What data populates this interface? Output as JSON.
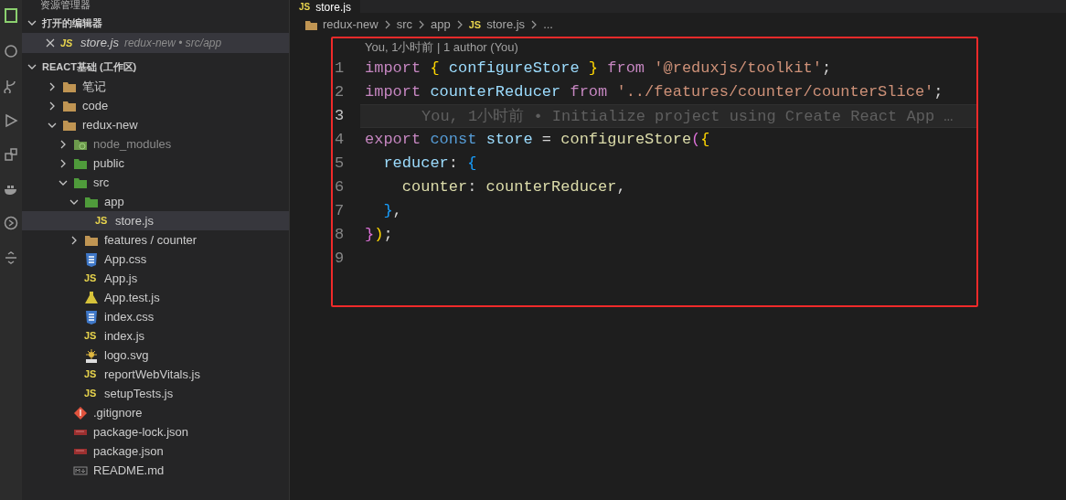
{
  "sidebar": {
    "title": "资源管理器",
    "open_editors": {
      "label": "打开的编辑器",
      "expanded": true,
      "items": [
        {
          "kind": "js",
          "badge": "JS",
          "label": "store.js",
          "description": "redux-new • src/app",
          "selected": true
        }
      ]
    },
    "workspace": {
      "label": "REACT基础 (工作区)",
      "expanded": true,
      "items": [
        {
          "kind": "folder",
          "label": "笔记",
          "expanded": false,
          "selected": false
        },
        {
          "kind": "folder",
          "label": "code",
          "expanded": false,
          "selected": false
        },
        {
          "kind": "folder",
          "label": "redux-new",
          "expanded": true,
          "selected": false,
          "children": [
            {
              "kind": "folder-node",
              "label": "node_modules",
              "expanded": false,
              "selected": false,
              "dimmed": true
            },
            {
              "kind": "folder-green",
              "label": "public",
              "expanded": false,
              "selected": false
            },
            {
              "kind": "folder-green",
              "label": "src",
              "expanded": true,
              "selected": false,
              "children": [
                {
                  "kind": "folder-green",
                  "label": "app",
                  "expanded": true,
                  "selected": false,
                  "children": [
                    {
                      "kind": "js",
                      "badge": "JS",
                      "label": "store.js",
                      "selected": true
                    }
                  ]
                },
                {
                  "kind": "folder",
                  "label": "features / counter",
                  "expanded": false,
                  "selected": false
                },
                {
                  "kind": "css",
                  "label": "App.css",
                  "selected": false
                },
                {
                  "kind": "js",
                  "badge": "JS",
                  "label": "App.js",
                  "selected": false
                },
                {
                  "kind": "test",
                  "label": "App.test.js",
                  "selected": false
                },
                {
                  "kind": "css",
                  "label": "index.css",
                  "selected": false
                },
                {
                  "kind": "js",
                  "badge": "JS",
                  "label": "index.js",
                  "selected": false
                },
                {
                  "kind": "svg",
                  "label": "logo.svg",
                  "selected": false
                },
                {
                  "kind": "js",
                  "badge": "JS",
                  "label": "reportWebVitals.js",
                  "selected": false
                },
                {
                  "kind": "js",
                  "badge": "JS",
                  "label": "setupTests.js",
                  "selected": false
                }
              ]
            },
            {
              "kind": "git",
              "label": ".gitignore",
              "selected": false
            },
            {
              "kind": "npm",
              "label": "package-lock.json",
              "selected": false
            },
            {
              "kind": "npm",
              "label": "package.json",
              "selected": false
            },
            {
              "kind": "md",
              "label": "README.md",
              "selected": false
            }
          ]
        }
      ]
    }
  },
  "editor": {
    "tab": {
      "badge": "JS",
      "label": "store.js",
      "selected": true
    },
    "breadcrumbs": [
      {
        "kind": "folder",
        "label": "redux-new"
      },
      {
        "label": "src"
      },
      {
        "label": "app"
      },
      {
        "kind": "js",
        "badge": "JS",
        "label": "store.js"
      },
      {
        "label": "..."
      }
    ],
    "blame": "You, 1小时前 | 1 author (You)",
    "lines": [
      {
        "number": "1",
        "current": false,
        "tokens": [
          {
            "kind": "control",
            "text": "import"
          },
          {
            "kind": "brace",
            "text": " {"
          },
          {
            "kind": "var",
            "text": " configureStore"
          },
          {
            "kind": "brace",
            "text": " }"
          },
          {
            "kind": "control",
            "text": " from"
          },
          {
            "kind": "string",
            "text": " '@reduxjs/toolkit'"
          },
          {
            "kind": "plain",
            "text": ";"
          }
        ]
      },
      {
        "number": "2",
        "current": false,
        "tokens": [
          {
            "kind": "control",
            "text": "import"
          },
          {
            "kind": "var",
            "text": " counterReducer"
          },
          {
            "kind": "control",
            "text": " from"
          },
          {
            "kind": "string",
            "text": " '../features/counter/counterSlice'"
          },
          {
            "kind": "plain",
            "text": ";"
          }
        ]
      },
      {
        "number": "3",
        "current": true,
        "ghost": "You, 1小时前 • Initialize project using Create React App …"
      },
      {
        "number": "4",
        "current": false,
        "tokens": [
          {
            "kind": "control",
            "text": "export"
          },
          {
            "kind": "storage",
            "text": " const"
          },
          {
            "kind": "var",
            "text": " store"
          },
          {
            "kind": "plain",
            "text": " ="
          },
          {
            "kind": "func",
            "text": " configureStore"
          },
          {
            "kind": "brace2",
            "text": "("
          },
          {
            "kind": "brace",
            "text": "{"
          }
        ]
      },
      {
        "number": "5",
        "current": false,
        "tokens": [
          {
            "kind": "prop",
            "text": "  reducer"
          },
          {
            "kind": "plain",
            "text": ":"
          },
          {
            "kind": "brace3",
            "text": " {"
          }
        ]
      },
      {
        "number": "6",
        "current": false,
        "tokens": [
          {
            "kind": "func",
            "text": "    counter"
          },
          {
            "kind": "plain",
            "text": ":"
          },
          {
            "kind": "func",
            "text": " counterReducer"
          },
          {
            "kind": "plain",
            "text": ","
          }
        ]
      },
      {
        "number": "7",
        "current": false,
        "tokens": [
          {
            "kind": "brace3",
            "text": "  }"
          },
          {
            "kind": "plain",
            "text": ","
          }
        ]
      },
      {
        "number": "8",
        "current": false,
        "tokens": [
          {
            "kind": "brace2",
            "text": "}"
          },
          {
            "kind": "brace",
            "text": ")"
          },
          {
            "kind": "plain",
            "text": ";"
          }
        ]
      },
      {
        "number": "9",
        "current": false
      }
    ]
  }
}
